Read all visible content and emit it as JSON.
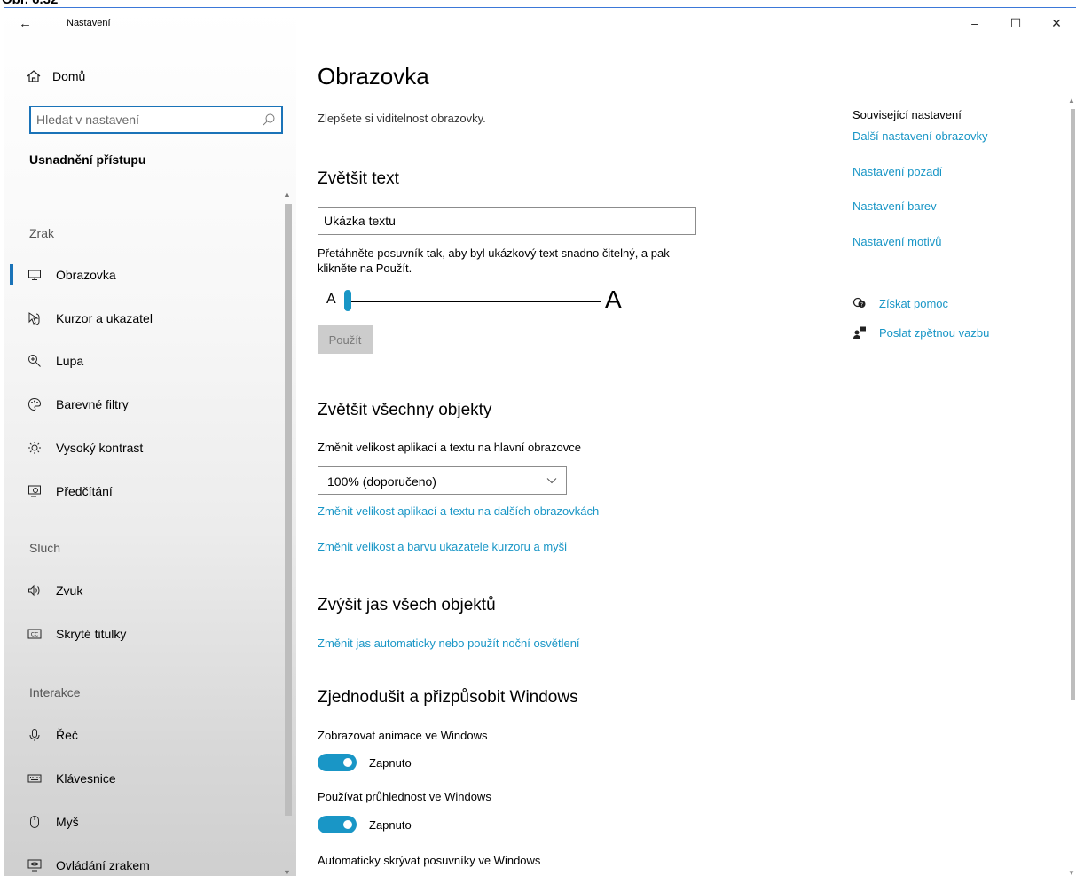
{
  "caption": "Obr. 6.32",
  "window": {
    "app_title": "Nastavení",
    "back_icon": "back-arrow-icon",
    "controls": {
      "minimize": "–",
      "maximize": "☐",
      "close": "✕"
    }
  },
  "sidebar": {
    "home_label": "Domů",
    "search_placeholder": "Hledat v nastavení",
    "section_title": "Usnadnění přístupu",
    "groups": [
      {
        "label": "Zrak"
      },
      {
        "label": "Sluch"
      },
      {
        "label": "Interakce"
      }
    ],
    "items": [
      {
        "label": "Obrazovka",
        "icon": "monitor-icon",
        "selected": true
      },
      {
        "label": "Kurzor a ukazatel",
        "icon": "cursor-icon"
      },
      {
        "label": "Lupa",
        "icon": "magnifier-icon"
      },
      {
        "label": "Barevné filtry",
        "icon": "palette-icon"
      },
      {
        "label": "Vysoký kontrast",
        "icon": "sun-icon"
      },
      {
        "label": "Předčítání",
        "icon": "narrator-icon"
      },
      {
        "label": "Zvuk",
        "icon": "speaker-icon"
      },
      {
        "label": "Skryté titulky",
        "icon": "cc-icon"
      },
      {
        "label": "Řeč",
        "icon": "microphone-icon"
      },
      {
        "label": "Klávesnice",
        "icon": "keyboard-icon"
      },
      {
        "label": "Myš",
        "icon": "mouse-icon"
      },
      {
        "label": "Ovládání zrakem",
        "icon": "eye-control-icon"
      }
    ]
  },
  "main": {
    "title": "Obrazovka",
    "subtitle": "Zlepšete si viditelnost obrazovky.",
    "text_size": {
      "heading": "Zvětšit text",
      "sample": "Ukázka textu",
      "instructions": "Přetáhněte posuvník tak, aby byl ukázkový text snadno čitelný, a pak klikněte na Použít.",
      "small_a": "A",
      "big_a": "A",
      "slider_value": 0,
      "apply": "Použít"
    },
    "scale": {
      "heading": "Zvětšit všechny objekty",
      "label": "Změnit velikost aplikací a textu na hlavní obrazovce",
      "selected": "100% (doporučeno)",
      "link1": "Změnit velikost aplikací a textu na dalších obrazovkách",
      "link2": "Změnit velikost a barvu ukazatele kurzoru a myši"
    },
    "brightness": {
      "heading": "Zvýšit jas všech objektů",
      "link": "Změnit jas automaticky nebo použít noční osvětlení"
    },
    "simplify": {
      "heading": "Zjednodušit a přizpůsobit Windows",
      "anim_label": "Zobrazovat animace ve Windows",
      "anim_state": "Zapnuto",
      "transp_label": "Používat průhlednost ve Windows",
      "transp_state": "Zapnuto",
      "scrollbars_label": "Automaticky skrývat posuvníky ve Windows"
    }
  },
  "related": {
    "title": "Související nastavení",
    "links": [
      "Další nastavení obrazovky",
      "Nastavení pozadí",
      "Nastavení barev",
      "Nastavení motivů"
    ],
    "help": "Získat pomoc",
    "feedback": "Poslat zpětnou vazbu"
  },
  "colors": {
    "accent": "#1996c6",
    "focus": "#1a73b8"
  }
}
